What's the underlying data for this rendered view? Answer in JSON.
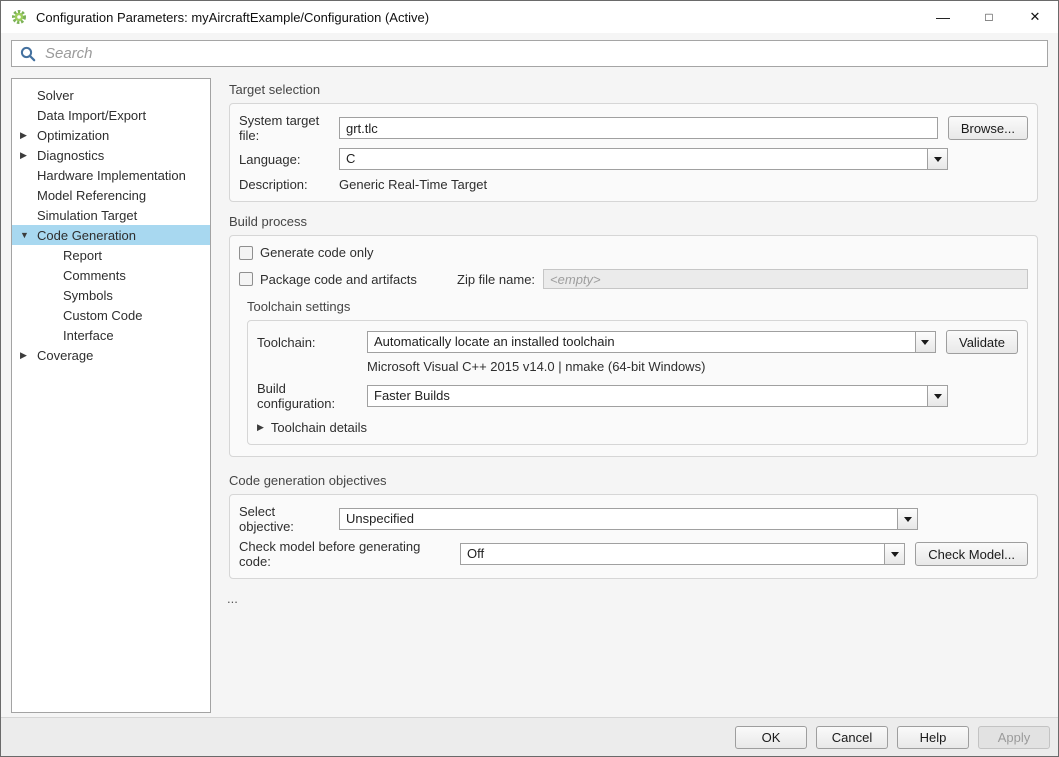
{
  "window": {
    "title": "Configuration Parameters: myAircraftExample/Configuration (Active)",
    "controls": {
      "minimize": "—",
      "maximize": "□",
      "close": "✕"
    }
  },
  "search": {
    "placeholder": "Search"
  },
  "sidebar": {
    "selected": "Code Generation",
    "items": [
      {
        "label": "Solver",
        "arrow": "",
        "level": 0,
        "selected": false
      },
      {
        "label": "Data Import/Export",
        "arrow": "",
        "level": 0,
        "selected": false
      },
      {
        "label": "Optimization",
        "arrow": "▶",
        "level": 0,
        "selected": false
      },
      {
        "label": "Diagnostics",
        "arrow": "▶",
        "level": 0,
        "selected": false
      },
      {
        "label": "Hardware Implementation",
        "arrow": "",
        "level": 0,
        "selected": false
      },
      {
        "label": "Model Referencing",
        "arrow": "",
        "level": 0,
        "selected": false
      },
      {
        "label": "Simulation Target",
        "arrow": "",
        "level": 0,
        "selected": false
      },
      {
        "label": "Code Generation",
        "arrow": "▼",
        "level": 0,
        "selected": true
      },
      {
        "label": "Report",
        "arrow": "",
        "level": 1,
        "selected": false
      },
      {
        "label": "Comments",
        "arrow": "",
        "level": 1,
        "selected": false
      },
      {
        "label": "Symbols",
        "arrow": "",
        "level": 1,
        "selected": false
      },
      {
        "label": "Custom Code",
        "arrow": "",
        "level": 1,
        "selected": false
      },
      {
        "label": "Interface",
        "arrow": "",
        "level": 1,
        "selected": false
      },
      {
        "label": "Coverage",
        "arrow": "▶",
        "level": 0,
        "selected": false
      }
    ]
  },
  "target_selection": {
    "title": "Target selection",
    "system_target_file": {
      "label": "System target file:",
      "value": "grt.tlc"
    },
    "browse_button": "Browse...",
    "language": {
      "label": "Language:",
      "value": "C"
    },
    "description": {
      "label": "Description:",
      "value": "Generic Real-Time Target"
    }
  },
  "build_process": {
    "title": "Build process",
    "generate_code_only": {
      "label": "Generate code only",
      "checked": false
    },
    "package_code": {
      "label": "Package code and artifacts",
      "checked": false
    },
    "zip_file_name": {
      "label": "Zip file name:",
      "value": "",
      "placeholder": "<empty>"
    },
    "toolchain_settings": {
      "title": "Toolchain settings",
      "toolchain": {
        "label": "Toolchain:",
        "value": "Automatically locate an installed toolchain"
      },
      "validate_button": "Validate",
      "toolchain_info": "Microsoft Visual C++ 2015 v14.0 | nmake (64-bit Windows)",
      "build_configuration": {
        "label": "Build configuration:",
        "value": "Faster Builds"
      },
      "details": {
        "arrow": "▶",
        "label": "Toolchain details"
      }
    }
  },
  "objectives": {
    "title": "Code generation objectives",
    "select_objective": {
      "label": "Select objective:",
      "value": "Unspecified"
    },
    "check_model": {
      "label": "Check model before generating code:",
      "value": "Off"
    },
    "check_model_button": "Check Model..."
  },
  "ellipsis": "...",
  "footer": {
    "ok": "OK",
    "cancel": "Cancel",
    "help": "Help",
    "apply": "Apply"
  },
  "colors": {
    "selection_highlight": "#a8d8f0",
    "app_icon_green": "#7cb257",
    "search_icon_blue": "#44719f"
  }
}
